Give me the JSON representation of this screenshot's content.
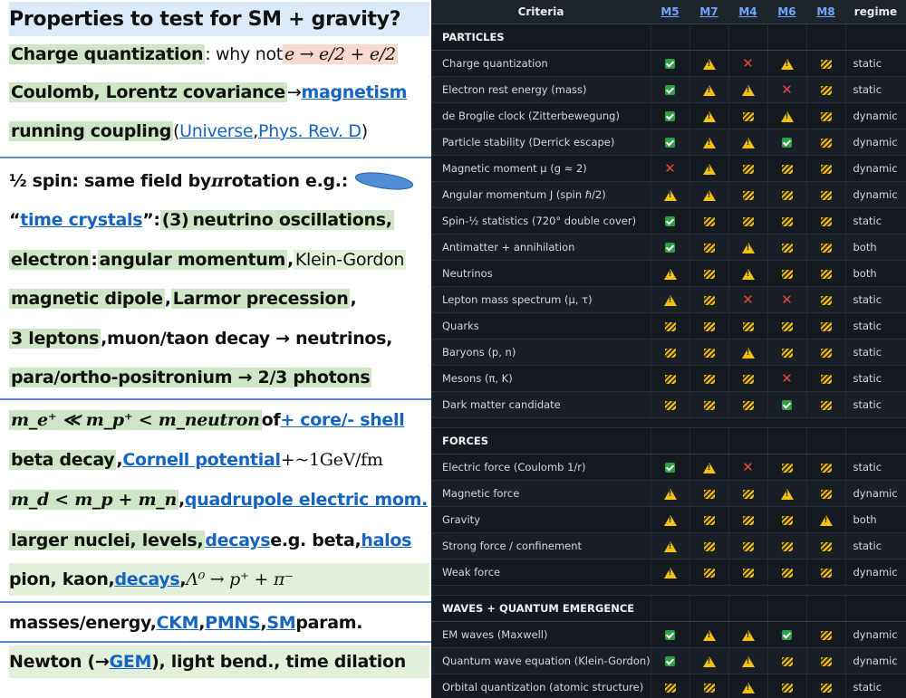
{
  "left": {
    "title": "Properties to test for SM + gravity?",
    "l1": {
      "a": "Charge quantization",
      "b": ": why not ",
      "m": "e → e/2 + e/2"
    },
    "l2": {
      "a": "Coulomb, Lorentz covariance",
      "b": " → ",
      "c": "magnetism"
    },
    "l3": {
      "a": "running coupling",
      "b": " (",
      "c": "Universe",
      ",": ", ",
      "d": "Phys. Rev. D",
      "e": ")"
    },
    "l4": {
      "a": "½ spin: same field by ",
      "m": "π",
      "b": " rotation e.g.:"
    },
    "l5": {
      "q1": "“",
      "a": "time crystals",
      "q2": "”: ",
      "b": "(3)",
      "c": " neutrino oscillations,"
    },
    "l6": {
      "a": "electron",
      "b": ": ",
      "c": "angular momentum",
      ",": ", ",
      "d": "Klein-Gordon"
    },
    "l7": {
      "a": "magnetic dipole",
      ",": ", ",
      "b": "Larmor precession",
      ",2": ","
    },
    "l8": {
      "a": "3 leptons",
      ",": ", ",
      "b": "muon/taon decay → neutrinos,"
    },
    "l9": {
      "a": "para/ortho-positronium → 2/3 photons"
    },
    "l10": {
      "m": "m_e⁺ ≪ m_p⁺ < m_neutron",
      "b": " of ",
      "c": "+ core/- shell"
    },
    "l11": {
      "a": "beta decay",
      ",": ", ",
      "b": "Cornell potential",
      "m": " +~1GeV/fm"
    },
    "l12": {
      "m": "m_d < m_p + m_n",
      ",": ", ",
      "b": "quadrupole electric mom."
    },
    "l13": {
      "a": "larger nuclei, levels, ",
      "b": "decays",
      "c": " e.g. beta, ",
      "d": "halos"
    },
    "l14": {
      "a": "pion, kaon, ",
      "b": "decays",
      ",": ", ",
      "m": "Λ⁰ → p⁺ + π⁻"
    },
    "l15": {
      "a": "masses/energy, ",
      "b": "CKM",
      ",": ", ",
      "c": "PMNS",
      ",2": ", ",
      "d": "SM",
      "e": " param."
    },
    "l16": {
      "a": "Newton (→",
      "b": "GEM",
      "c": "), light bend., time dilation"
    }
  },
  "table": {
    "headers": [
      "Criteria",
      "M5",
      "M7",
      "M4",
      "M6",
      "M8",
      "regime"
    ],
    "sections": [
      {
        "title": "PARTICLES",
        "rows": [
          {
            "c": "Charge quantization",
            "m": [
              "ok",
              "warn",
              "x",
              "warn",
              "cond"
            ],
            "r": "static"
          },
          {
            "c": "Electron rest energy (mass)",
            "m": [
              "ok",
              "warn",
              "warn",
              "x",
              "cond"
            ],
            "r": "static"
          },
          {
            "c": "de Broglie clock (Zitterbewegung)",
            "m": [
              "ok",
              "warn",
              "cond",
              "warn",
              "cond"
            ],
            "r": "dynamic"
          },
          {
            "c": "Particle stability (Derrick escape)",
            "m": [
              "ok",
              "warn",
              "warn",
              "ok",
              "cond"
            ],
            "r": "dynamic"
          },
          {
            "c": "Magnetic moment μ (g ≈ 2)",
            "m": [
              "x",
              "warn",
              "cond",
              "cond",
              "cond"
            ],
            "r": "dynamic"
          },
          {
            "c": "Angular momentum J (spin ℏ/2)",
            "m": [
              "warn",
              "warn",
              "cond",
              "cond",
              "cond"
            ],
            "r": "dynamic"
          },
          {
            "c": "Spin-½ statistics (720° double cover)",
            "m": [
              "ok",
              "cond",
              "cond",
              "cond",
              "cond"
            ],
            "r": "static"
          },
          {
            "c": "Antimatter + annihilation",
            "m": [
              "ok",
              "cond",
              "warn",
              "cond",
              "cond"
            ],
            "r": "both"
          },
          {
            "c": "Neutrinos",
            "m": [
              "warn",
              "cond",
              "warn",
              "cond",
              "cond"
            ],
            "r": "both"
          },
          {
            "c": "Lepton mass spectrum (μ, τ)",
            "m": [
              "warn",
              "cond",
              "x",
              "x",
              "cond"
            ],
            "r": "static"
          },
          {
            "c": "Quarks",
            "m": [
              "cond",
              "cond",
              "cond",
              "cond",
              "cond"
            ],
            "r": "static"
          },
          {
            "c": "Baryons (p, n)",
            "m": [
              "cond",
              "cond",
              "warn",
              "cond",
              "cond"
            ],
            "r": "static"
          },
          {
            "c": "Mesons (π, K)",
            "m": [
              "cond",
              "cond",
              "cond",
              "x",
              "cond"
            ],
            "r": "static"
          },
          {
            "c": "Dark matter candidate",
            "m": [
              "cond",
              "cond",
              "cond",
              "ok",
              "cond"
            ],
            "r": "static"
          }
        ]
      },
      {
        "title": "FORCES",
        "rows": [
          {
            "c": "Electric force (Coulomb 1/r)",
            "m": [
              "ok",
              "warn",
              "x",
              "cond",
              "cond"
            ],
            "r": "static"
          },
          {
            "c": "Magnetic force",
            "m": [
              "warn",
              "cond",
              "cond",
              "warn",
              "cond"
            ],
            "r": "dynamic"
          },
          {
            "c": "Gravity",
            "m": [
              "warn",
              "cond",
              "cond",
              "cond",
              "warn"
            ],
            "r": "both"
          },
          {
            "c": "Strong force / confinement",
            "m": [
              "warn",
              "cond",
              "cond",
              "cond",
              "cond"
            ],
            "r": "static"
          },
          {
            "c": "Weak force",
            "m": [
              "warn",
              "cond",
              "cond",
              "cond",
              "cond"
            ],
            "r": "dynamic"
          }
        ]
      },
      {
        "title": "WAVES + QUANTUM EMERGENCE",
        "rows": [
          {
            "c": "EM waves (Maxwell)",
            "m": [
              "ok",
              "warn",
              "warn",
              "ok",
              "cond"
            ],
            "r": "dynamic"
          },
          {
            "c": "Quantum wave equation (Klein-Gordon)",
            "m": [
              "ok",
              "warn",
              "warn",
              "cond",
              "cond"
            ],
            "r": "dynamic"
          },
          {
            "c": "Orbital quantization (atomic structure)",
            "m": [
              "cond",
              "cond",
              "warn",
              "cond",
              "cond"
            ],
            "r": "static"
          }
        ]
      }
    ]
  },
  "icons": {
    "ok": "check-icon",
    "warn": "warning-icon",
    "x": "cross-icon",
    "cond": "conditional-icon"
  },
  "colors": {
    "accent": "#1565c0",
    "highlight": "#cfe6c6",
    "separator": "#5b8dd0",
    "table_bg": "#151a21"
  }
}
